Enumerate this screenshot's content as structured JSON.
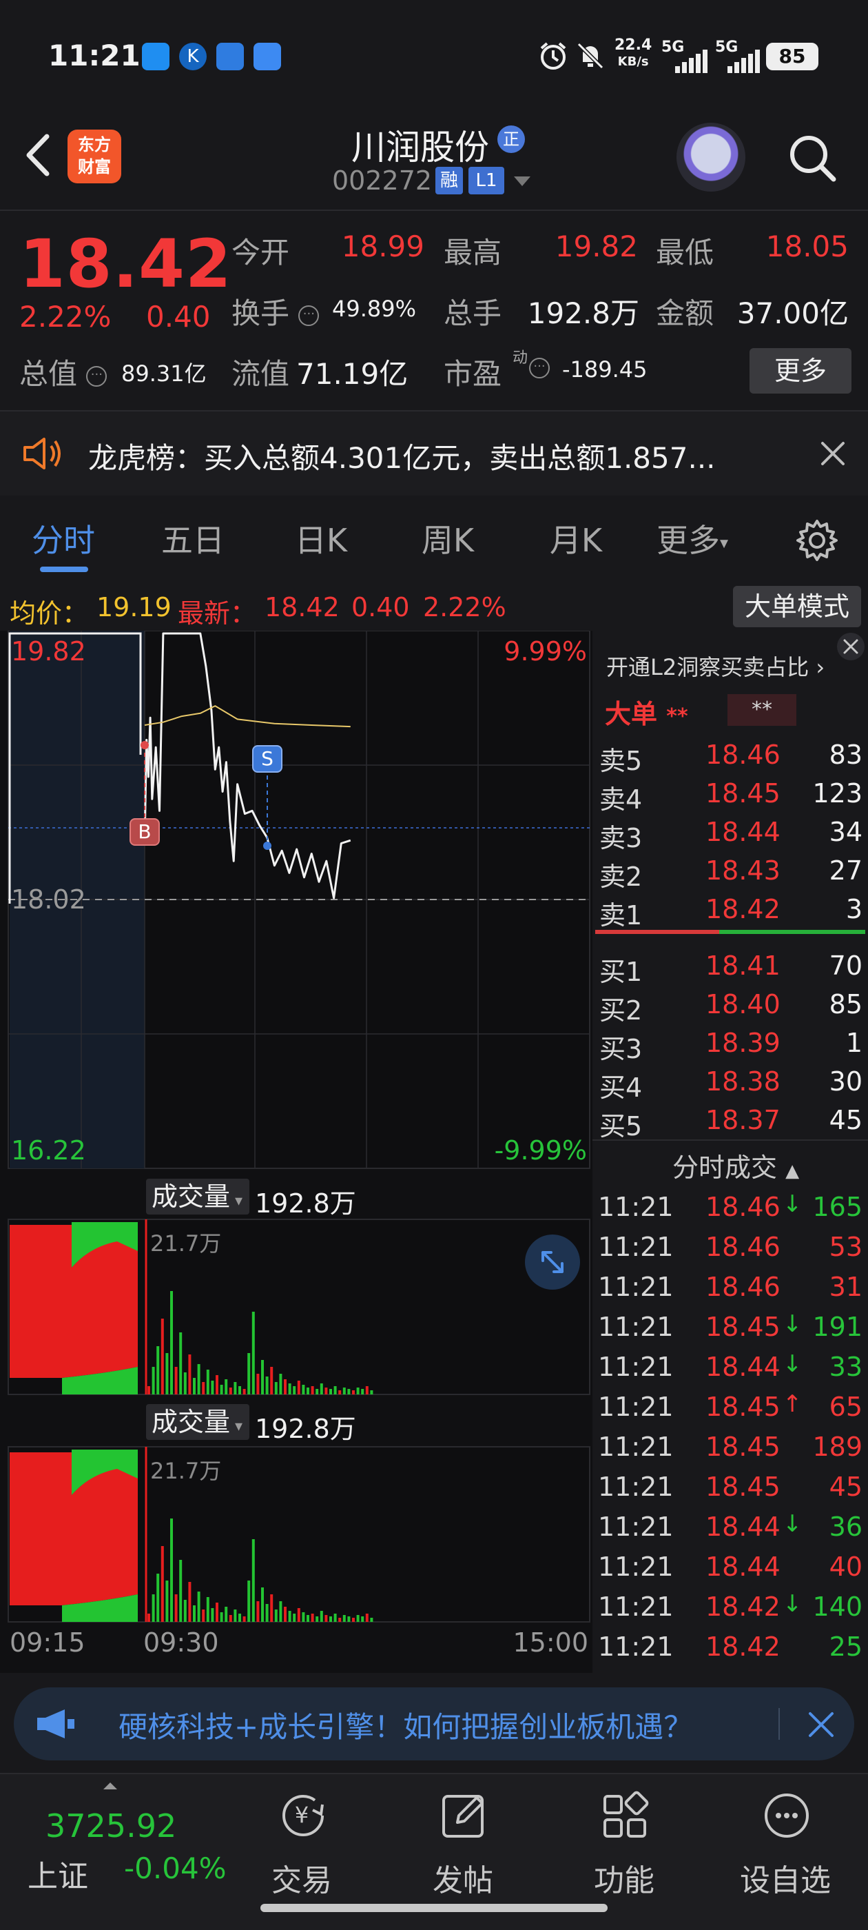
{
  "status_bar": {
    "time": "11:21",
    "net_speed_value": "22.4",
    "net_speed_unit": "KB/s",
    "network1": "5G",
    "network2": "5G",
    "battery": "85",
    "icons": [
      "app-icon-blue",
      "app-icon-k",
      "app-icon-cloud",
      "app-icon-chat",
      "alarm-icon",
      "mute-icon",
      "signal-icon"
    ]
  },
  "header": {
    "logo_line1": "东方",
    "logo_line2": "财富",
    "stock_name": "川润股份",
    "zheng_badge": "正",
    "stock_code": "002272",
    "rong_badge": "融",
    "level_badge": "L1"
  },
  "quote": {
    "price": "18.42",
    "change_pct": "2.22%",
    "change_amt": "0.40",
    "open_label": "今开",
    "open_value": "18.99",
    "high_label": "最高",
    "high_value": "19.82",
    "low_label": "最低",
    "low_value": "18.05",
    "turnover_label": "换手",
    "turnover_value": "49.89%",
    "volume_label": "总手",
    "volume_value": "192.8万",
    "amount_label": "金额",
    "amount_value": "37.00亿",
    "mktcap_label": "总值",
    "mktcap_value": "89.31亿",
    "float_label": "流值",
    "float_value": "71.19亿",
    "pe_label": "市盈",
    "pe_sup": "动",
    "pe_value": "-189.45",
    "more_button": "更多"
  },
  "dragon_banner": {
    "text": "龙虎榜：买入总额4.301亿元，卖出总额1.857..."
  },
  "tabs": [
    "分时",
    "五日",
    "日K",
    "周K",
    "月K",
    "更多"
  ],
  "avg_line": {
    "avg_label": "均价：",
    "avg_value": "19.19",
    "latest_label": "最新：",
    "latest_value": "18.42",
    "chg_amt": "0.40",
    "chg_pct": "2.22%",
    "mode_button": "大单模式"
  },
  "chart": {
    "y_top": "19.82",
    "y_mid": "18.02",
    "y_bottom": "16.22",
    "pct_top": "9.99%",
    "pct_bottom": "-9.99%",
    "b_marker": "B",
    "s_marker": "S",
    "volume_label": "成交量",
    "volume_value": "192.8万",
    "volume_max": "21.7万",
    "time_start": "09:15",
    "time_open": "09:30",
    "time_end": "15:00"
  },
  "chart_data": {
    "type": "line",
    "title": "",
    "xlabel": "",
    "ylabel": "",
    "x_ticks": [
      "09:15",
      "09:30",
      "15:00"
    ],
    "ylim": [
      16.22,
      19.82
    ],
    "prev_close": 18.02,
    "series": [
      {
        "name": "",
        "x": [
          "09:30",
          "09:31",
          "09:32",
          "09:33",
          "09:34",
          "09:36",
          "09:38",
          "09:40",
          "09:45",
          "09:50",
          "09:55",
          "10:00",
          "10:03",
          "10:06",
          "10:08",
          "10:10",
          "10:12",
          "10:14",
          "10:16",
          "10:18",
          "10:20",
          "10:24",
          "10:28",
          "10:32",
          "10:36",
          "10:40",
          "10:44",
          "10:48",
          "10:52",
          "10:56",
          "11:00",
          "11:04",
          "11:08",
          "11:12",
          "11:16",
          "11:21"
        ],
        "values": [
          18.41,
          19.1,
          18.85,
          19.25,
          18.7,
          19.05,
          18.62,
          19.82,
          19.82,
          19.82,
          19.82,
          19.82,
          19.6,
          19.3,
          18.9,
          19.05,
          18.75,
          18.95,
          18.55,
          18.28,
          18.8,
          18.6,
          18.62,
          18.52,
          18.44,
          18.25,
          18.35,
          18.2,
          18.36,
          18.17,
          18.33,
          18.14,
          18.28,
          18.03,
          18.4,
          18.42
        ]
      },
      {
        "name": "均价",
        "x": [
          "09:30",
          "09:40",
          "09:50",
          "10:00",
          "10:08",
          "10:20",
          "10:40",
          "11:00",
          "11:21"
        ],
        "values": [
          19.2,
          19.22,
          19.26,
          19.28,
          19.33,
          19.24,
          19.21,
          19.2,
          19.19
        ]
      }
    ]
  },
  "orderbook": {
    "side_title": "开通L2洞察买卖占比",
    "big_label": "大单",
    "big_stars": "**",
    "big_stars2": "**",
    "asks": [
      {
        "label": "卖5",
        "price": "18.46",
        "vol": "83"
      },
      {
        "label": "卖4",
        "price": "18.45",
        "vol": "123"
      },
      {
        "label": "卖3",
        "price": "18.44",
        "vol": "34"
      },
      {
        "label": "卖2",
        "price": "18.43",
        "vol": "27"
      },
      {
        "label": "卖1",
        "price": "18.42",
        "vol": "3"
      }
    ],
    "bids": [
      {
        "label": "买1",
        "price": "18.41",
        "vol": "70"
      },
      {
        "label": "买2",
        "price": "18.40",
        "vol": "85"
      },
      {
        "label": "买3",
        "price": "18.39",
        "vol": "1"
      },
      {
        "label": "买4",
        "price": "18.38",
        "vol": "30"
      },
      {
        "label": "买5",
        "price": "18.37",
        "vol": "45"
      }
    ],
    "ticks_title": "分时成交",
    "ticks": [
      {
        "time": "11:21",
        "price": "18.46",
        "arrow": "↓",
        "vol": "165",
        "dir": "down"
      },
      {
        "time": "11:21",
        "price": "18.46",
        "arrow": "",
        "vol": "53",
        "dir": "up"
      },
      {
        "time": "11:21",
        "price": "18.46",
        "arrow": "",
        "vol": "31",
        "dir": "up"
      },
      {
        "time": "11:21",
        "price": "18.45",
        "arrow": "↓",
        "vol": "191",
        "dir": "down"
      },
      {
        "time": "11:21",
        "price": "18.44",
        "arrow": "↓",
        "vol": "33",
        "dir": "down"
      },
      {
        "time": "11:21",
        "price": "18.45",
        "arrow": "↑",
        "vol": "65",
        "dir": "up"
      },
      {
        "time": "11:21",
        "price": "18.45",
        "arrow": "",
        "vol": "189",
        "dir": "up"
      },
      {
        "time": "11:21",
        "price": "18.45",
        "arrow": "",
        "vol": "45",
        "dir": "up"
      },
      {
        "time": "11:21",
        "price": "18.44",
        "arrow": "↓",
        "vol": "36",
        "dir": "down"
      },
      {
        "time": "11:21",
        "price": "18.44",
        "arrow": "",
        "vol": "40",
        "dir": "up"
      },
      {
        "time": "11:21",
        "price": "18.42",
        "arrow": "↓",
        "vol": "140",
        "dir": "down"
      },
      {
        "time": "11:21",
        "price": "18.42",
        "arrow": "",
        "vol": "25",
        "dir": "down"
      }
    ]
  },
  "ad": {
    "text": "硬核科技+成长引擎！如何把握创业板机遇？"
  },
  "bottom_nav": {
    "index_value": "3725.92",
    "index_name": "上证",
    "index_change": "-0.04%",
    "items": [
      "交易",
      "发帖",
      "功能",
      "设自选"
    ],
    "trade_icon_char": "¥"
  },
  "colors": {
    "up": "#f23838",
    "down": "#27c43a",
    "accent": "#4f8fe8",
    "background": "#18181b"
  }
}
